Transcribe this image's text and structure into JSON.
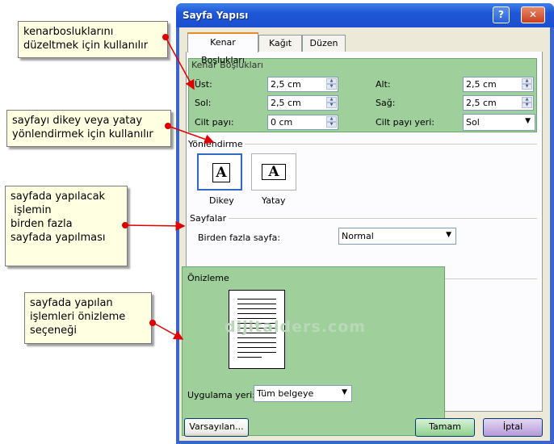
{
  "dialog": {
    "title": "Sayfa Yapısı",
    "help_button": "?",
    "close_button": "✕"
  },
  "tabs": [
    {
      "label": "Kenar Boşlukları",
      "active": true
    },
    {
      "label": "Kağıt",
      "active": false
    },
    {
      "label": "Düzen",
      "active": false
    }
  ],
  "margins": {
    "section_title": "Kenar Boşlukları",
    "top_label": "Üst:",
    "top_value": "2,5 cm",
    "bottom_label": "Alt:",
    "bottom_value": "2,5 cm",
    "left_label": "Sol:",
    "left_value": "2,5 cm",
    "right_label": "Sağ:",
    "right_value": "2,5 cm",
    "gutter_label": "Cilt payı:",
    "gutter_value": "0 cm",
    "gutter_pos_label": "Cilt payı yeri:",
    "gutter_pos_value": "Sol"
  },
  "orientation": {
    "section_title": "Yönlendirme",
    "glyph": "A",
    "portrait_label": "Dikey",
    "landscape_label": "Yatay",
    "selected": "portrait"
  },
  "pages": {
    "section_title": "Sayfalar",
    "multiple_label": "Birden fazla sayfa:",
    "multiple_value": "Normal"
  },
  "preview": {
    "section_title": "Önizleme",
    "apply_label": "Uygulama yeri:",
    "apply_value": "Tüm belgeye"
  },
  "buttons": {
    "default": "Varsayılan...",
    "ok": "Tamam",
    "cancel": "İptal"
  },
  "watermark": "dijitalders.com",
  "callouts": [
    {
      "text": "kenarbosluklarını\ndüzeltmek için kullanılır"
    },
    {
      "text": "sayfayı dikey veya yatay\nyönlendirmek için kullanılır"
    },
    {
      "text": "sayfada yapılacak\n işlemin\nbirden fazla\nsayfada yapılması"
    },
    {
      "text": "sayfada yapılan\nişlemleri önizleme\nseçeneği"
    }
  ],
  "colors": {
    "highlight_green": "#9fcf9a",
    "callout_bg": "#ffffe1",
    "arrow_red": "#e00000",
    "titlebar_blue": "#1f57d6"
  }
}
